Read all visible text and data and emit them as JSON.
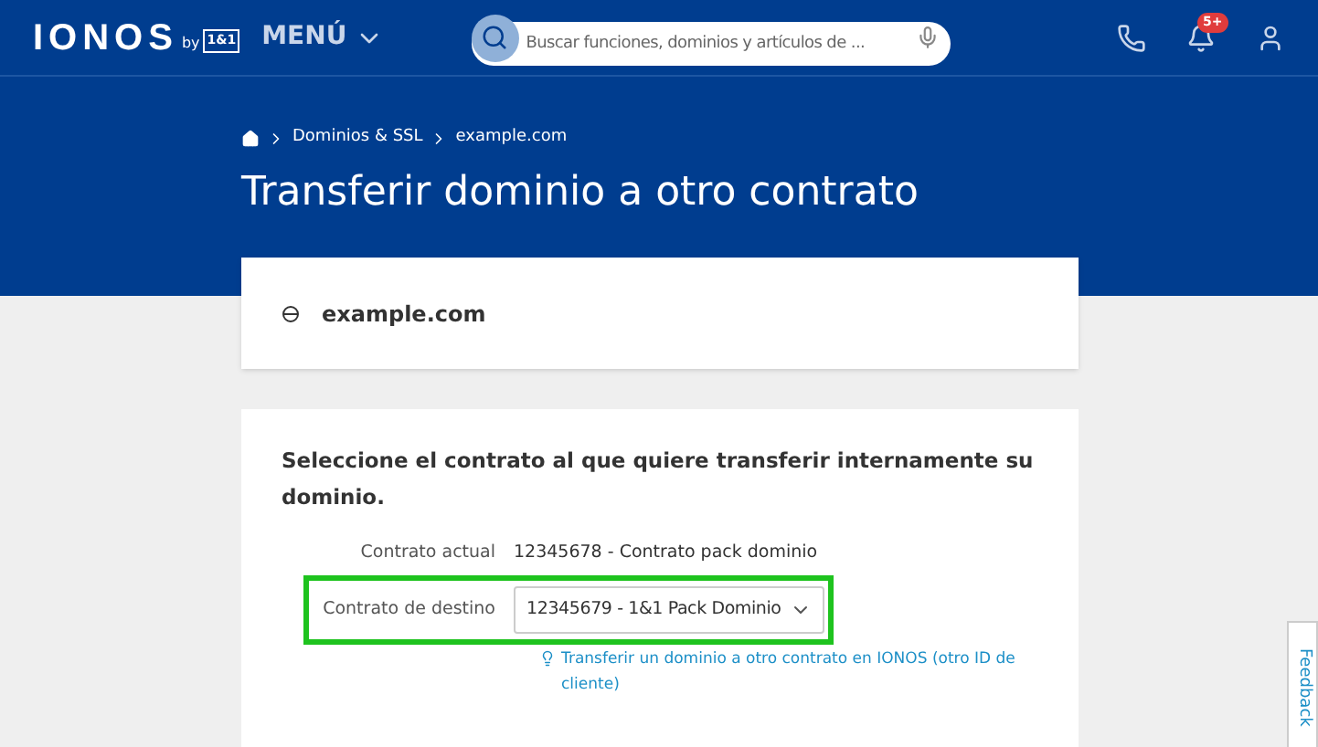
{
  "header": {
    "logo": "IONOS",
    "logo_by": "by",
    "logo_badge": "1&1",
    "menu": "MENÚ",
    "search": {
      "placeholder": "Buscar funciones, dominios y artículos de ..."
    },
    "notification_badge": "5+"
  },
  "breadcrumb": [
    "Dominios & SSL",
    "example.com"
  ],
  "title": "Transferir dominio a otro contrato",
  "domain": "example.com",
  "form": {
    "heading": "Seleccione el contrato al que quiere transferir internamente su dominio.",
    "rows": [
      {
        "kind": "text",
        "label": "Contrato actual",
        "value": "12345678 - Contrato pack dominio",
        "highlighted": false
      },
      {
        "kind": "select",
        "label": "Contrato de destino",
        "value": "12345679 - 1&1 Pack Dominio",
        "highlighted": true
      }
    ],
    "hint_link": "Transferir un dominio a otro contrato en IONOS (otro ID de cliente)"
  },
  "feedback_tab": "Feedback"
}
